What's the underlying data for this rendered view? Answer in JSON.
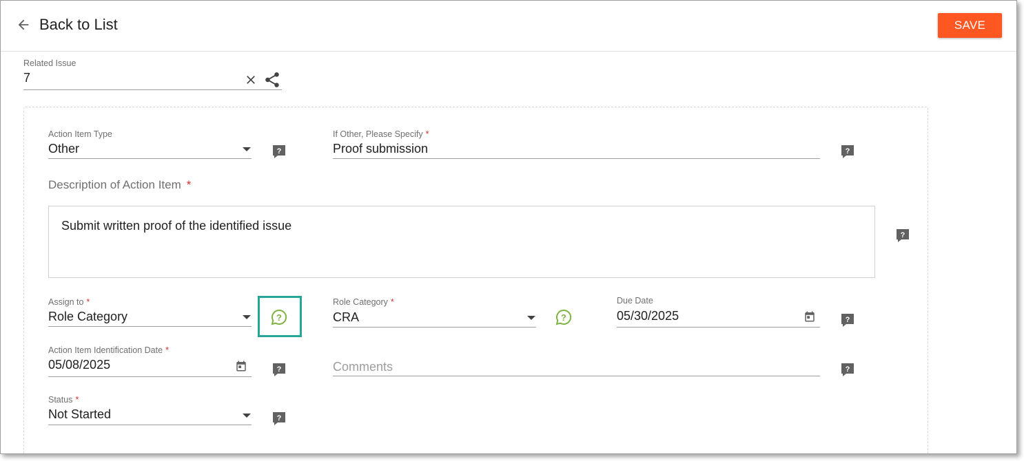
{
  "header": {
    "back_label": "Back to List",
    "save_label": "SAVE"
  },
  "related_issue": {
    "label": "Related Issue",
    "value": "7"
  },
  "action_item_type": {
    "label": "Action Item Type",
    "value": "Other"
  },
  "if_other": {
    "label": "If Other, Please Specify",
    "required_mark": "*",
    "value": "Proof submission"
  },
  "description": {
    "label": "Description of Action Item",
    "required_mark": "*",
    "value": "Submit written proof of the identified issue"
  },
  "assign_to": {
    "label": "Assign to",
    "required_mark": "*",
    "value": "Role Category"
  },
  "role_category": {
    "label": "Role Category",
    "required_mark": "*",
    "value": "CRA"
  },
  "due_date": {
    "label": "Due Date",
    "value": "05/30/2025"
  },
  "identification_date": {
    "label": "Action Item Identification Date",
    "required_mark": "*",
    "value": "05/08/2025"
  },
  "comments": {
    "placeholder": "Comments"
  },
  "status": {
    "label": "Status",
    "required_mark": "*",
    "value": "Not Started"
  },
  "colors": {
    "accent": "#ff5722",
    "required": "#d32f2f",
    "help_green": "#7cb342",
    "highlight": "#26a69a",
    "help_gray": "#616161"
  }
}
